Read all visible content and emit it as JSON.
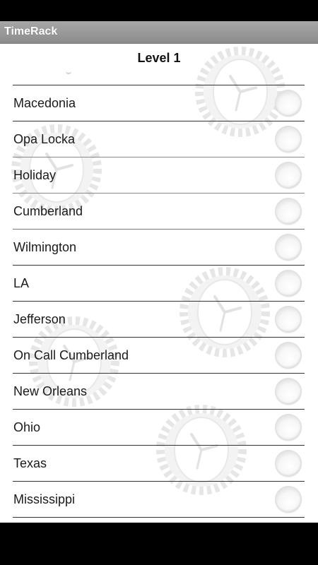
{
  "app": {
    "title": "TimeRack"
  },
  "page": {
    "title": "Level 1"
  },
  "locations": [
    {
      "label": "Macedonia"
    },
    {
      "label": "Opa Locka"
    },
    {
      "label": "Holiday"
    },
    {
      "label": "Cumberland"
    },
    {
      "label": "Wilmington"
    },
    {
      "label": "LA"
    },
    {
      "label": "Jefferson"
    },
    {
      "label": "On Call Cumberland"
    },
    {
      "label": "New Orleans"
    },
    {
      "label": "Ohio"
    },
    {
      "label": "Texas"
    },
    {
      "label": "Mississippi"
    }
  ],
  "colors": {
    "title_bar": "#999999",
    "background": "#ffffff",
    "divider": "#333333"
  },
  "icons": {
    "background_pattern": "gear-clock-icon",
    "selector": "radio-circle"
  }
}
